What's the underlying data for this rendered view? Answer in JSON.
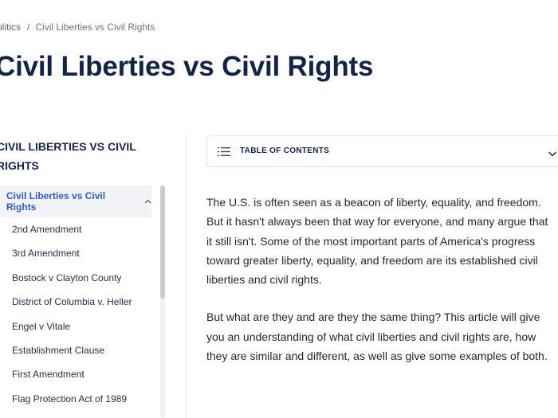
{
  "breadcrumb": {
    "parent": "olitics",
    "separator": "/",
    "current": "Civil Liberties vs Civil Rights"
  },
  "page": {
    "title": "Civil Liberties vs Civil Rights"
  },
  "sidebar": {
    "heading_line1": "CIVIL LIBERTIES VS CIVIL",
    "heading_line2": "RIGHTS",
    "active_item": "Civil Liberties vs Civil Rights",
    "items": [
      "2nd Amendment",
      "3rd Amendment",
      "Bostock v Clayton County",
      "District of Columbia v. Heller",
      "Engel v Vitale",
      "Establishment Clause",
      "First Amendment",
      "Flag Protection Act of 1989"
    ]
  },
  "toc": {
    "label": "TABLE OF CONTENTS"
  },
  "content": {
    "paragraph1_lines": [
      "The U.S. is often seen as a beacon of liberty, equality, and freedom.",
      "But it hasn't always been that way for everyone, and many argue that",
      "it still isn't. Some of the most important parts of America's progress",
      "toward greater liberty, equality, and freedom are its established civil",
      "liberties and civil rights."
    ],
    "paragraph2_lines": [
      "But what are they and are they the same thing? This article will give",
      "you an understanding of what civil liberties and civil rights are, how",
      "they are similar and different, as well as give some examples of both."
    ]
  },
  "colors": {
    "title": "#142447",
    "accent_link": "#2d5bb8",
    "active_bg": "#f1f3f6",
    "border": "#e1e4ea"
  },
  "icons": {
    "toc": "list-icon",
    "toc_toggle": "chevron-down-icon",
    "sidebar_collapse": "chevron-up-icon"
  }
}
